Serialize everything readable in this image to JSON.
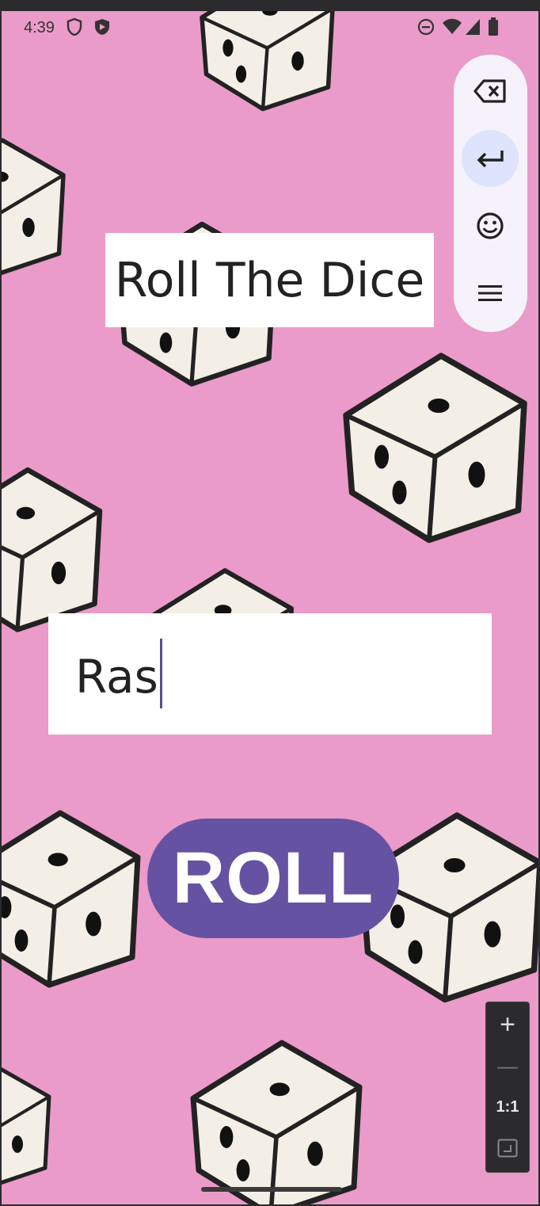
{
  "status_bar": {
    "time": "4:39"
  },
  "app": {
    "title": "Roll The Dice",
    "name_input": {
      "value": "Ras"
    },
    "roll_button": "ROLL"
  },
  "keyboard_toolbar": {
    "keys": [
      "backspace-icon",
      "enter-icon",
      "emoji-icon",
      "menu-icon"
    ]
  },
  "zoom_controls": {
    "zoom_in": "+",
    "zoom_out": "—",
    "actual_size": "1:1"
  },
  "colors": {
    "background": "#ea9bc9",
    "accent": "#6652a2"
  }
}
